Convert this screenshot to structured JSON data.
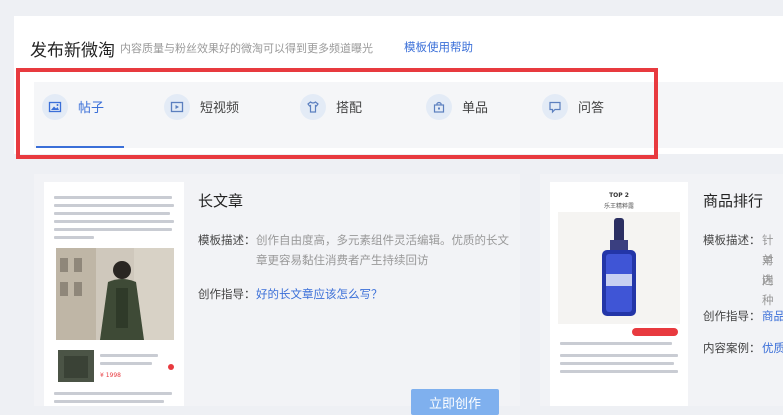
{
  "header": {
    "title": "发布新微淘",
    "subtitle": "内容质量与粉丝效果好的微淘可以得到更多频道曝光",
    "help_link": "模板使用帮助"
  },
  "tabs": [
    {
      "label": "帖子",
      "icon": "image-icon",
      "active": true
    },
    {
      "label": "短视频",
      "icon": "video-icon",
      "active": false
    },
    {
      "label": "搭配",
      "icon": "shirt-icon",
      "active": false
    },
    {
      "label": "单品",
      "icon": "bag-icon",
      "active": false
    },
    {
      "label": "问答",
      "icon": "chat-icon",
      "active": false
    }
  ],
  "templates": [
    {
      "title": "长文章",
      "desc_label": "模板描述：",
      "desc": "创作自由度高，多元素组件灵活编辑。优质的长文章更容易黏住消费者产生持续回访",
      "guide_label": "创作指导：",
      "guide_link": "好的长文章应该怎么写？",
      "button": "立即创作",
      "preview_price": "¥ 1998"
    },
    {
      "title": "商品排行",
      "desc_label": "模板描述：",
      "desc_partial": "针对",
      "desc_line2": "单内",
      "desc_line3": "迷种",
      "guide_label": "创作指导：",
      "guide_link": "商品",
      "case_label": "内容案例：",
      "case_link": "优质",
      "preview_top": "TOP 2",
      "preview_sub": "乐王精粹露"
    }
  ],
  "colors": {
    "accent": "#3a6fd8",
    "highlight": "#e83a3f",
    "button": "#7fb0ee"
  }
}
